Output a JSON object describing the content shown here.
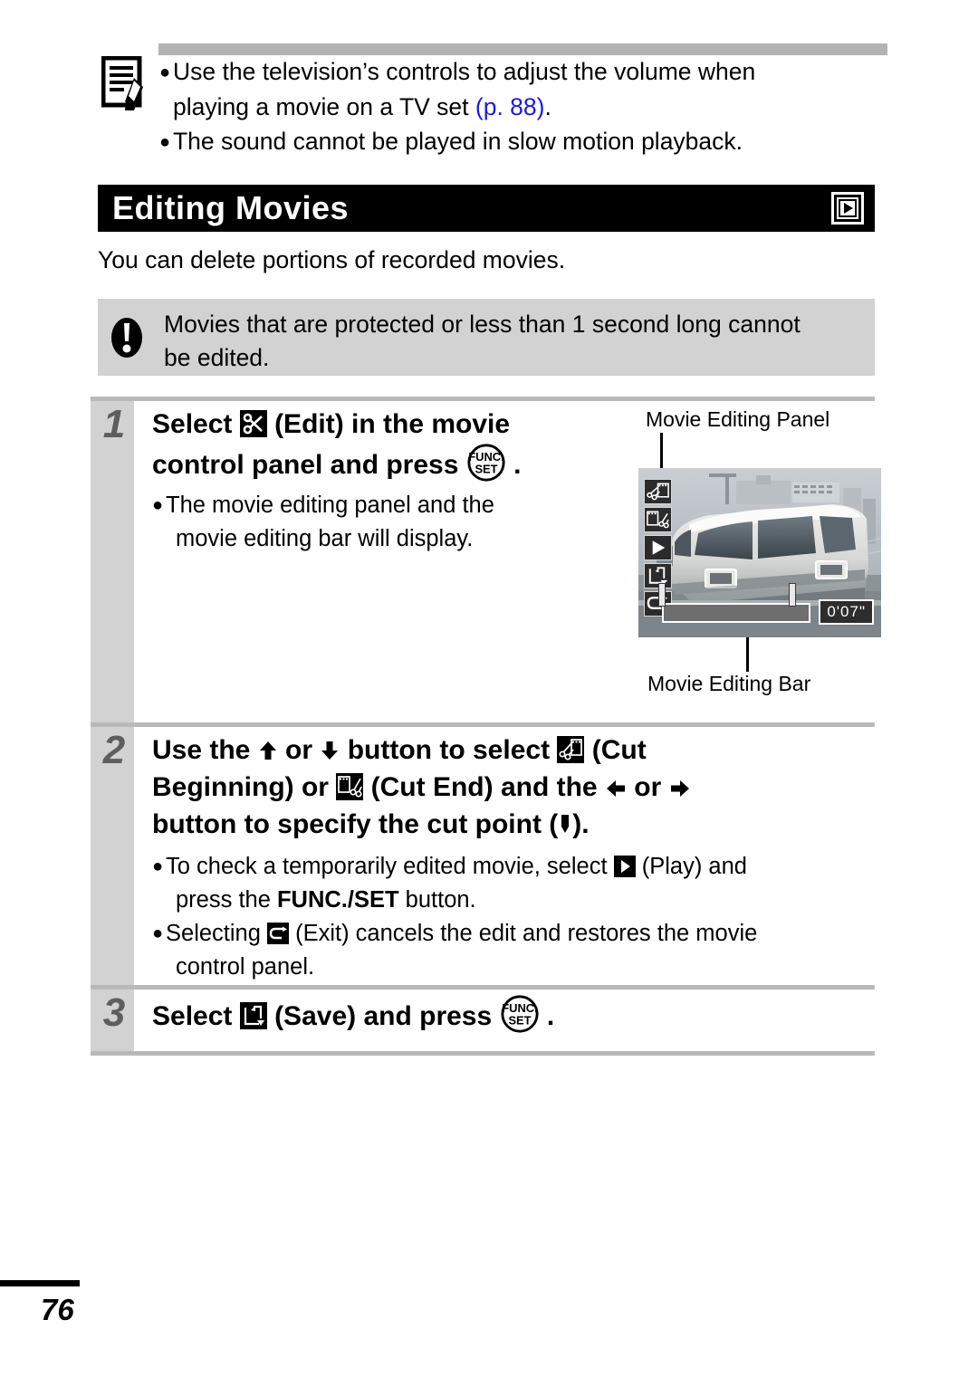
{
  "note": {
    "icon": "memo-pencil-icon",
    "bullets": [
      {
        "line1": "Use the television’s controls to adjust the volume when",
        "line2_pre": "playing a movie on a TV set ",
        "line2_ref": "(p. 88)",
        "line2_post": "."
      },
      {
        "line1": "The sound cannot be played in slow motion playback."
      }
    ]
  },
  "title": {
    "text": "Editing Movies",
    "mode_icon": "playback-mode-icon"
  },
  "intro": "You can delete portions of recorded movies.",
  "caution": {
    "icon": "exclamation-icon",
    "line1": "Movies that are protected or less than 1 second long cannot",
    "line2": "be edited."
  },
  "steps": [
    {
      "number": "1",
      "head": [
        {
          "pre": "Select ",
          "icon": "edit-scissors-icon",
          "post": " (Edit) in the movie"
        },
        {
          "pre": "control panel and press ",
          "icon": "func-set-icon",
          "post": " ."
        }
      ],
      "subs": [
        {
          "line1": "The movie editing panel and the",
          "line2": "movie editing bar will display."
        }
      ]
    },
    {
      "number": "2",
      "head": [
        {
          "pre": "Use the ",
          "icon": "arrow-up-icon",
          "mid": " or ",
          "icon2": "arrow-down-icon",
          "mid2": " button to select ",
          "icon3": "cut-beginning-icon",
          "post": " (Cut"
        },
        {
          "pre": "Beginning) or ",
          "icon": "cut-end-icon",
          "mid": " (Cut End) and the ",
          "icon2": "arrow-left-icon",
          "mid2": " or ",
          "icon3": "arrow-right-icon",
          "post": ""
        },
        {
          "pre": "button to specify the cut point (",
          "icon": "cut-point-marker-icon",
          "post": ")."
        }
      ],
      "subs": [
        {
          "line1_pre": "To check a temporarily edited movie, select ",
          "line1_icon": "play-icon",
          "line1_post": " (Play) and",
          "line2_pre": "press the ",
          "line2_bold": "FUNC./SET",
          "line2_post": " button."
        },
        {
          "line1_pre": "Selecting ",
          "line1_icon": "exit-icon",
          "line1_post": " (Exit) cancels the edit and restores the movie",
          "line2_pre": "control panel."
        }
      ]
    },
    {
      "number": "3",
      "head": [
        {
          "pre": "Select ",
          "icon": "save-icon",
          "mid": " (Save) and press ",
          "icon2": "func-set-icon",
          "post": " ."
        }
      ],
      "subs": []
    }
  ],
  "screen_figure": {
    "label_top": "Movie Editing Panel",
    "label_bottom": "Movie Editing Bar",
    "panel_icons": [
      "cut-beginning-icon",
      "cut-end-icon",
      "play-icon",
      "save-icon",
      "exit-icon"
    ],
    "time_display": "0'07\"",
    "subject": "monorail-train-photo"
  },
  "footer": {
    "page_number": "76"
  }
}
